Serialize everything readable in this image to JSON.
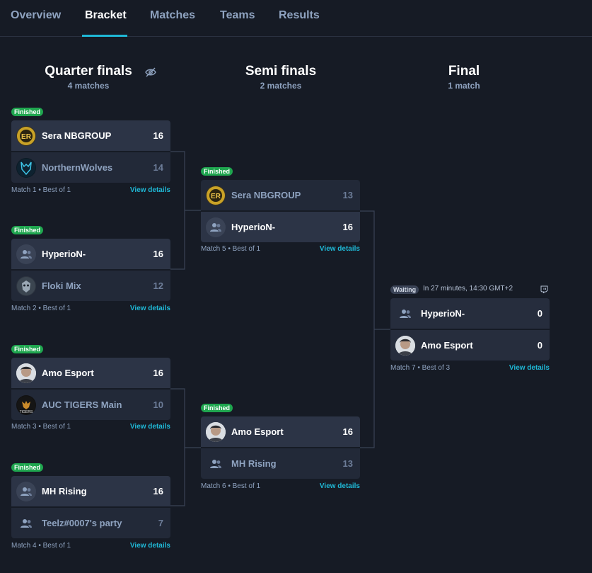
{
  "tabs": [
    {
      "label": "Overview"
    },
    {
      "label": "Bracket"
    },
    {
      "label": "Matches"
    },
    {
      "label": "Teams"
    },
    {
      "label": "Results"
    }
  ],
  "active_tab": "Bracket",
  "columns": {
    "quarter": {
      "title": "Quarter finals",
      "sub": "4 matches"
    },
    "semi": {
      "title": "Semi finals",
      "sub": "2 matches"
    },
    "final": {
      "title": "Final",
      "sub": "1 match"
    }
  },
  "view_details": "View details",
  "matches": [
    {
      "status": "Finished",
      "meta": "Match 1 • Best of 1",
      "team1": {
        "name": "Sera NBGROUP",
        "score": "16",
        "icon": "er-logo-icon"
      },
      "team2": {
        "name": "NorthernWolves",
        "score": "14",
        "icon": "wolf-logo-icon"
      }
    },
    {
      "status": "Finished",
      "meta": "Match 2 • Best of 1",
      "team1": {
        "name": "HyperioN-",
        "score": "16",
        "icon": "group-icon"
      },
      "team2": {
        "name": "Floki Mix",
        "score": "12",
        "icon": "floki-avatar-icon"
      }
    },
    {
      "status": "Finished",
      "meta": "Match 3 • Best of 1",
      "team1": {
        "name": "Amo Esport",
        "score": "16",
        "icon": "amo-avatar-icon"
      },
      "team2": {
        "name": "AUC TIGERS Main",
        "score": "10",
        "icon": "tigers-logo-icon"
      }
    },
    {
      "status": "Finished",
      "meta": "Match 4 • Best of 1",
      "team1": {
        "name": "MH Rising",
        "score": "16",
        "icon": "group-icon"
      },
      "team2": {
        "name": "Teelz#0007's party",
        "score": "7",
        "icon": "group-icon"
      }
    },
    {
      "status": "Finished",
      "meta": "Match 5 • Best of 1",
      "team1": {
        "name": "Sera NBGROUP",
        "score": "13",
        "icon": "er-logo-icon"
      },
      "team2": {
        "name": "HyperioN-",
        "score": "16",
        "icon": "group-icon"
      }
    },
    {
      "status": "Finished",
      "meta": "Match 6 • Best of 1",
      "team1": {
        "name": "Amo Esport",
        "score": "16",
        "icon": "amo-avatar-icon"
      },
      "team2": {
        "name": "MH Rising",
        "score": "13",
        "icon": "group-icon"
      }
    },
    {
      "status": "Waiting",
      "when": "In 27 minutes, 14:30 GMT+2",
      "meta": "Match 7 • Best of 3",
      "team1": {
        "name": "HyperioN-",
        "score": "0",
        "icon": "group-icon"
      },
      "team2": {
        "name": "Amo Esport",
        "score": "0",
        "icon": "amo-avatar-icon"
      }
    }
  ],
  "colors": {
    "background": "#161b25",
    "accent": "#1fb8d6",
    "finished": "#1fa64f",
    "win_row": "#2c3446",
    "lose_row": "#222938"
  }
}
